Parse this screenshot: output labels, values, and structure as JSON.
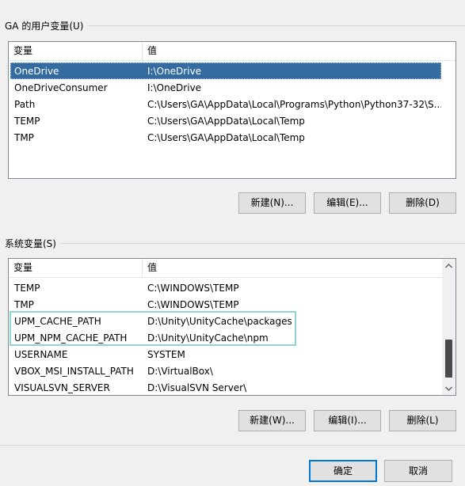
{
  "user_vars": {
    "group_title": "GA 的用户变量(U)",
    "columns": [
      "变量",
      "值"
    ],
    "rows": [
      {
        "name": "OneDrive",
        "value": "I:\\OneDrive",
        "selected": true
      },
      {
        "name": "OneDriveConsumer",
        "value": "I:\\OneDrive",
        "selected": false
      },
      {
        "name": "Path",
        "value": "C:\\Users\\GA\\AppData\\Local\\Programs\\Python\\Python37-32\\S...",
        "selected": false
      },
      {
        "name": "TEMP",
        "value": "C:\\Users\\GA\\AppData\\Local\\Temp",
        "selected": false
      },
      {
        "name": "TMP",
        "value": "C:\\Users\\GA\\AppData\\Local\\Temp",
        "selected": false
      }
    ],
    "buttons": {
      "new": "新建(N)...",
      "edit": "编辑(E)...",
      "delete": "删除(D)"
    }
  },
  "system_vars": {
    "group_title": "系统变量(S)",
    "columns": [
      "变量",
      "值"
    ],
    "rows": [
      {
        "name": "TEMP",
        "value": "C:\\WINDOWS\\TEMP"
      },
      {
        "name": "TMP",
        "value": "C:\\WINDOWS\\TEMP"
      },
      {
        "name": "UPM_CACHE_PATH",
        "value": "D:\\Unity\\UnityCache\\packages"
      },
      {
        "name": "UPM_NPM_CACHE_PATH",
        "value": "D:\\Unity\\UnityCache\\npm"
      },
      {
        "name": "USERNAME",
        "value": "SYSTEM"
      },
      {
        "name": "VBOX_MSI_INSTALL_PATH",
        "value": "D:\\VirtualBox\\"
      },
      {
        "name": "VISUALSVN_SERVER",
        "value": "D:\\VisualSVN Server\\"
      }
    ],
    "buttons": {
      "new": "新建(W)...",
      "edit": "编辑(I)...",
      "delete": "删除(L)"
    }
  },
  "footer": {
    "ok": "确定",
    "cancel": "取消"
  },
  "colors": {
    "selection": "#346ba0",
    "highlight_outline": "#8fd3d6"
  },
  "icons": {
    "scroll_up": "chevron-up-icon",
    "scroll_down": "chevron-down-icon"
  }
}
